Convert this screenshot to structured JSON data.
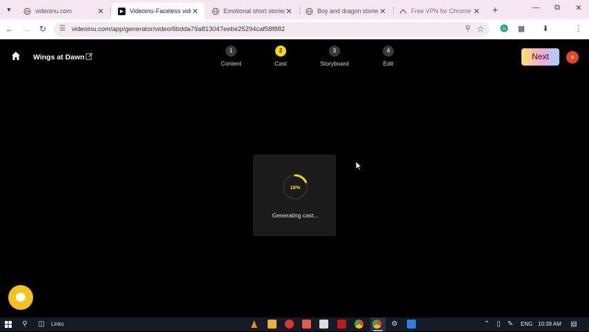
{
  "browser": {
    "tabs": [
      {
        "title": "videoinu.com",
        "active": false,
        "favicon": "globe-icon"
      },
      {
        "title": "Videoinu-Faceless video",
        "active": true,
        "favicon": "videoinu-icon"
      },
      {
        "title": "Emotional short stories",
        "active": false,
        "favicon": "globe-icon"
      },
      {
        "title": "Boy and dragon stories",
        "active": false,
        "favicon": "globe-icon"
      },
      {
        "title": "Free VPN for Chrome - V",
        "active": false,
        "favicon": "vpn-icon"
      }
    ],
    "url": "videoinu.com/app/generator/video/6bdda79a813047eebe25294caf58f882"
  },
  "app": {
    "project_title": "Wings at Dawn",
    "steps": [
      {
        "number": "1",
        "label": "Content",
        "current": false
      },
      {
        "number": "2",
        "label": "Cast",
        "current": true
      },
      {
        "number": "3",
        "label": "Storyboard",
        "current": false
      },
      {
        "number": "4",
        "label": "Edit",
        "current": false
      }
    ],
    "next_label": "Next",
    "avatar_initial": "a",
    "loader": {
      "percent_text": "18%",
      "progress": 0.18,
      "status_text": "Generating cast..."
    },
    "colors": {
      "accent": "#f5d90a",
      "background": "#000000",
      "card": "#1b1b1b",
      "avatar": "#e8462a"
    }
  },
  "taskbar": {
    "links_label": "Links",
    "language": "ENG",
    "time": "10:39 AM"
  }
}
